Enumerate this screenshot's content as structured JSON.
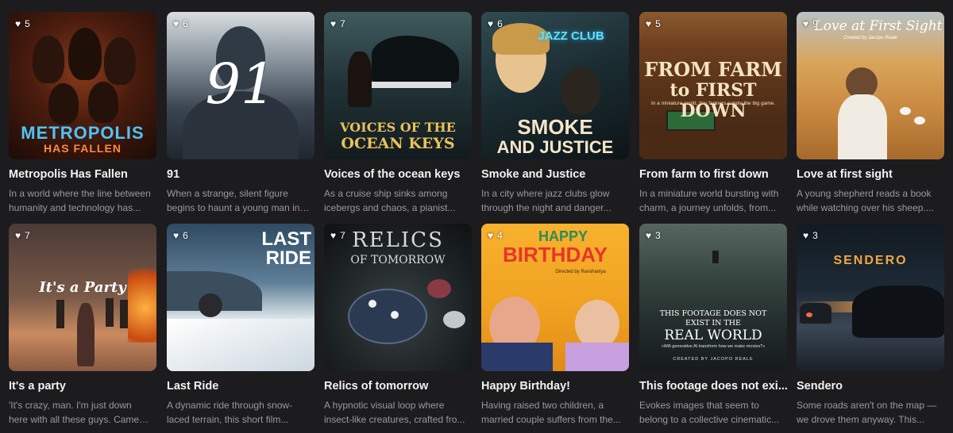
{
  "cards": [
    {
      "likes": "5",
      "title": "Metropolis Has Fallen",
      "description": "In a world where the line between humanity and technology has...",
      "poster_text": [
        "METROPOLIS",
        "HAS FALLEN"
      ],
      "colors": {
        "bg": "#3a1a10",
        "accent": "#4fc3f7"
      }
    },
    {
      "likes": "6",
      "title": "91",
      "description": "When a strange, silent figure begins to haunt a young man in ...",
      "poster_text": [
        "91"
      ],
      "colors": {
        "bg": "#3b4652"
      }
    },
    {
      "likes": "7",
      "title": "Voices of the ocean keys",
      "description": "As a cruise ship sinks among icebergs and chaos, a pianist...",
      "poster_text": [
        "VOICES OF THE",
        "OCEAN KEYS"
      ],
      "colors": {
        "bg": "#1f2e33",
        "accent": "#e8c15a"
      }
    },
    {
      "likes": "6",
      "title": "Smoke and Justice",
      "description": "In a city where jazz clubs glow through the night and danger...",
      "poster_text": [
        "JAZZ CLUB",
        "SMOKE",
        "AND JUSTICE"
      ],
      "colors": {
        "bg": "#1c2a2e",
        "accent": "#f5e6c8"
      }
    },
    {
      "likes": "5",
      "title": "From farm to first down",
      "description": "In a miniature world bursting with charm, a journey unfolds, from...",
      "poster_text": [
        "FROM FARM",
        "to FIRST DOWN",
        "In a miniature world, tiny farmers supply the big game."
      ],
      "colors": {
        "bg": "#6b3a1c",
        "accent": "#f4e3c0"
      }
    },
    {
      "likes": "9",
      "title": "Love at first sight",
      "description": "A young shepherd reads a book while watching over his sheep....",
      "poster_text": [
        "Love at First Sight",
        "Created by Jacopo Reale"
      ],
      "colors": {
        "bg": "#d9a45a",
        "accent": "#ffffff"
      }
    },
    {
      "likes": "7",
      "title": "It's a party",
      "description": "'It's crazy, man. I'm just down here with all these guys. Came down...",
      "poster_text": [
        "It's a Party"
      ],
      "colors": {
        "bg": "#6b4a3e",
        "accent": "#ffffff"
      }
    },
    {
      "likes": "6",
      "title": "Last Ride",
      "description": "A dynamic ride through snow-laced terrain, this short film...",
      "poster_text": [
        "LAST",
        "RIDE"
      ],
      "colors": {
        "bg": "#3e5b73",
        "accent": "#ffffff"
      }
    },
    {
      "likes": "7",
      "title": "Relics of tomorrow",
      "description": "A hypnotic visual loop where insect-like creatures, crafted fro...",
      "poster_text": [
        "RELICS",
        "OF TOMORROW"
      ],
      "colors": {
        "bg": "#1d2224",
        "accent": "#d8d8d8"
      }
    },
    {
      "likes": "4",
      "title": "Happy Birthday!",
      "description": "Having raised two children, a married couple suffers from the...",
      "poster_text": [
        "HAPPY",
        "BIRTHDAY",
        "Directed by Ravshaniya"
      ],
      "colors": {
        "bg": "#f0a020",
        "accent": "#e8352a"
      }
    },
    {
      "likes": "3",
      "title": "This footage does not exi...",
      "description": "Evokes images that seem to belong to a collective cinematic...",
      "poster_text": [
        "THIS FOOTAGE DOES NOT",
        "EXIST IN THE",
        "REAL WORLD",
        "«Will generative AI transform how we make movies?»",
        "CREATED BY JACOPO REALE"
      ],
      "colors": {
        "bg": "#2a3430",
        "accent": "#ffffff"
      }
    },
    {
      "likes": "3",
      "title": "Sendero",
      "description": "Some roads aren't on the map — we drove them anyway. This...",
      "poster_text": [
        "SENDERO"
      ],
      "colors": {
        "bg": "#1d2a36",
        "accent": "#f0a840"
      }
    }
  ]
}
